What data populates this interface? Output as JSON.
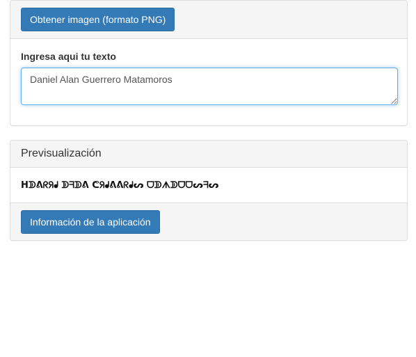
{
  "top_panel": {
    "export_button_label": "Obtener imagen (formato PNG)",
    "input_label": "Ingresa aqui tu texto",
    "input_value": "Daniel Alan Guerrero Matamoros"
  },
  "preview_panel": {
    "title": "Previsualización",
    "preview_text": "ᕼᗫᕕᖇᖆᖱ ᗫᖷᗫᕕ ᕦᖆᖱᕕᕕᖇᖱᔕ ᗜᗫᗑᗫᗜᗜᔕᖷᔕ",
    "info_button_label": "Información de la aplicación"
  },
  "colors": {
    "primary": "#337ab7",
    "panel_bg": "#f5f5f5",
    "border": "#dddddd",
    "focus": "#66afe9"
  }
}
